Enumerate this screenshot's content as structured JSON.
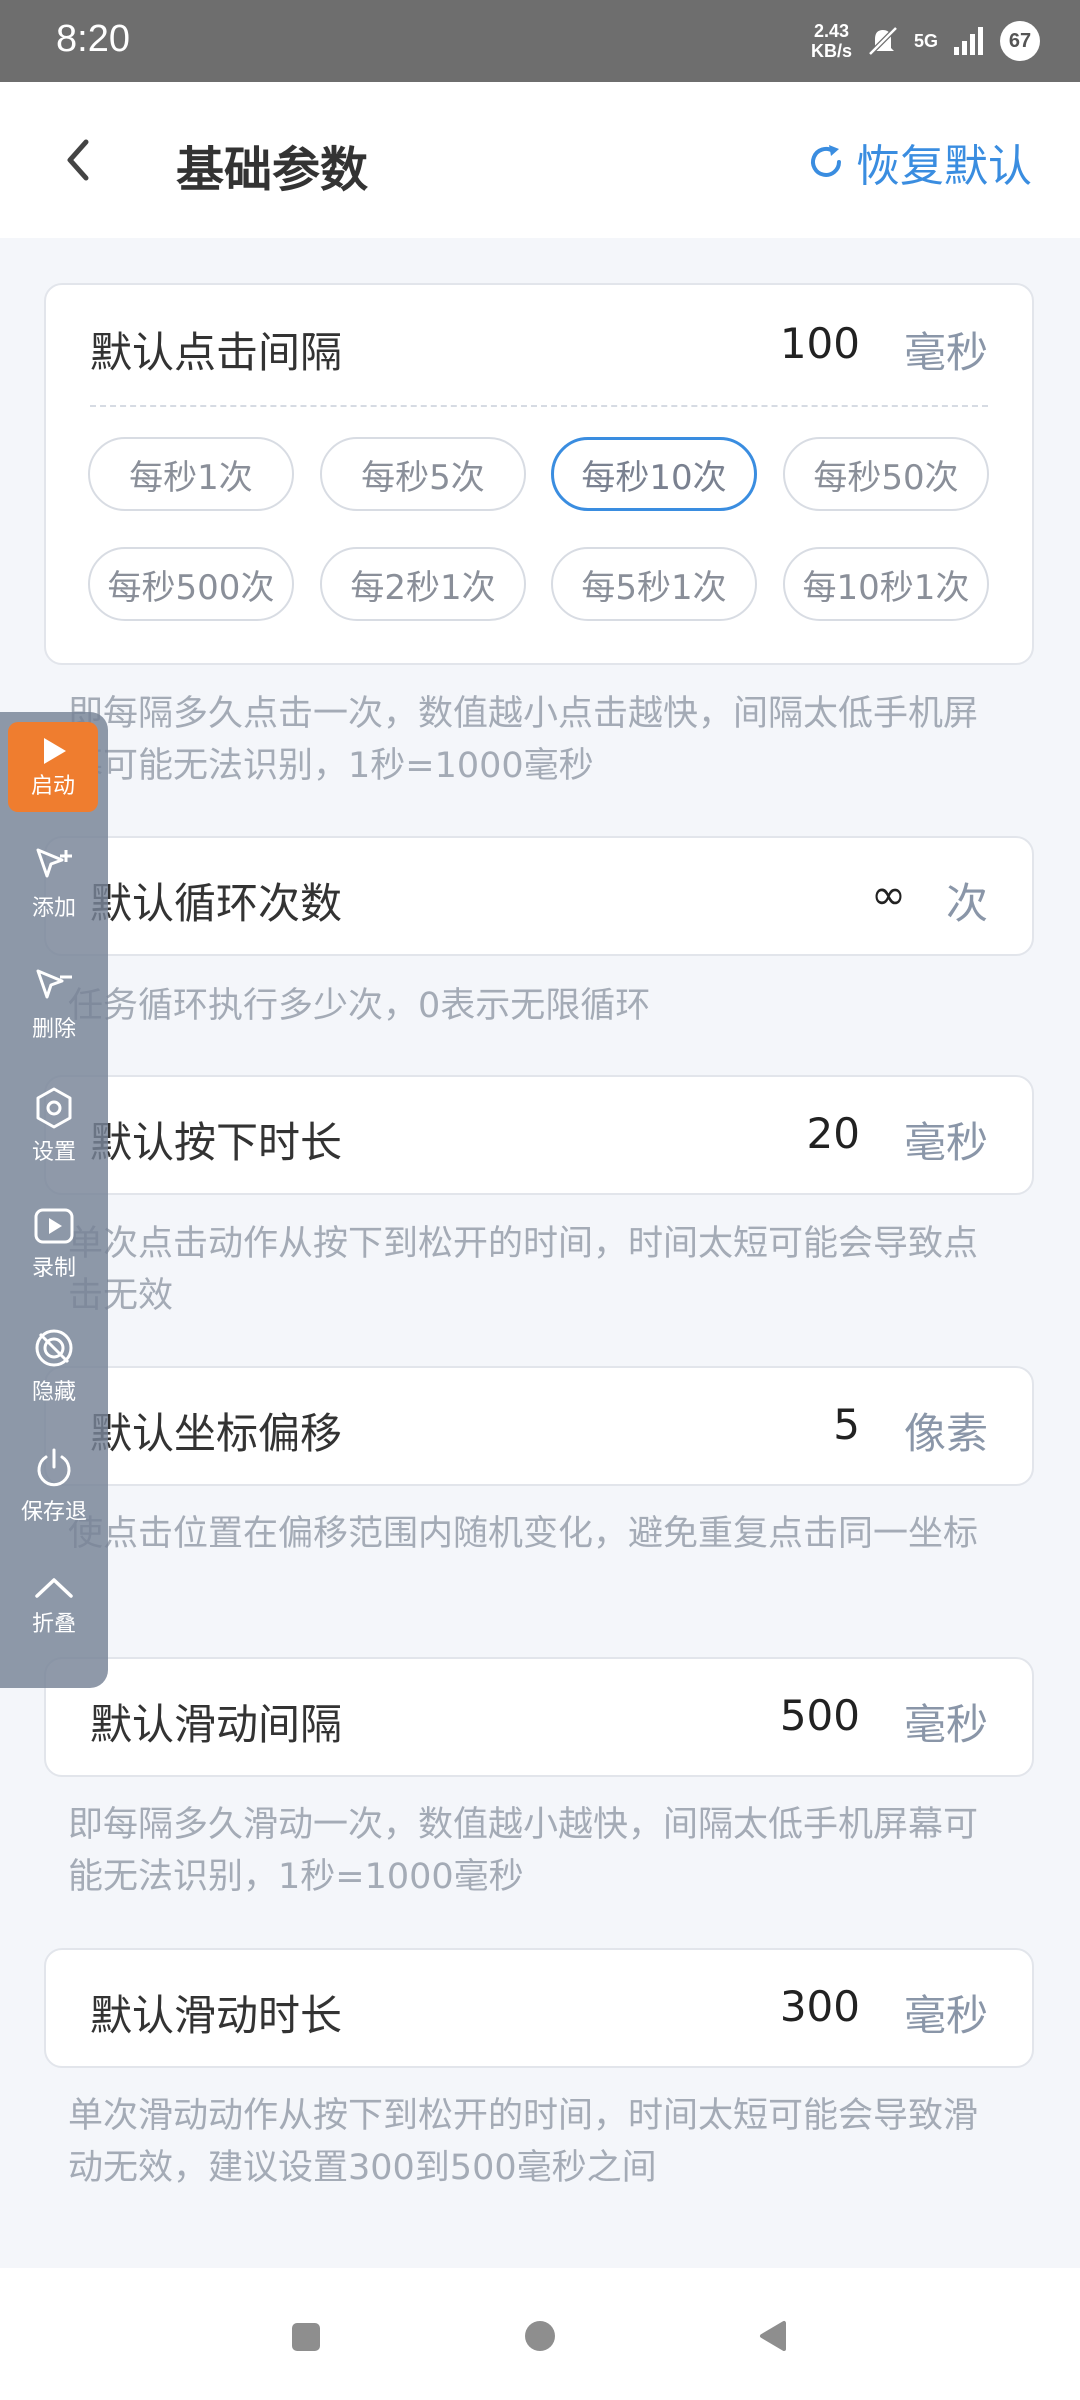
{
  "status_bar": {
    "time": "8:20",
    "speed_value": "2.43",
    "speed_unit": "KB/s",
    "network": "5G",
    "battery": "67"
  },
  "header": {
    "title": "基础参数",
    "restore_label": "恢复默认"
  },
  "settings": {
    "click_interval": {
      "label": "默认点击间隔",
      "value": "100",
      "unit": "毫秒",
      "presets": [
        "每秒1次",
        "每秒5次",
        "每秒10次",
        "每秒50次",
        "每秒500次",
        "每2秒1次",
        "每5秒1次",
        "每10秒1次"
      ],
      "selected_preset": "每秒10次",
      "description": "即每隔多久点击一次，数值越小点击越快，间隔太低手机屏幕可能无法识别，1秒=1000毫秒"
    },
    "loop_count": {
      "label": "默认循环次数",
      "value": "∞",
      "unit": "次",
      "description": "任务循环执行多少次，0表示无限循环"
    },
    "press_duration": {
      "label": "默认按下时长",
      "value": "20",
      "unit": "毫秒",
      "description": "单次点击动作从按下到松开的时间，时间太短可能会导致点击无效"
    },
    "coordinate_offset": {
      "label": "默认坐标偏移",
      "value": "5",
      "unit": "像素",
      "description": "使点击位置在偏移范围内随机变化，避免重复点击同一坐标"
    },
    "swipe_interval": {
      "label": "默认滑动间隔",
      "value": "500",
      "unit": "毫秒",
      "description": "即每隔多久滑动一次，数值越小越快，间隔太低手机屏幕可能无法识别，1秒=1000毫秒"
    },
    "swipe_duration": {
      "label": "默认滑动时长",
      "value": "300",
      "unit": "毫秒",
      "description": "单次滑动动作从按下到松开的时间，时间太短可能会导致滑动无效，建议设置300到500毫秒之间"
    }
  },
  "floating_toolbar": {
    "start": "启动",
    "add": "添加",
    "delete": "删除",
    "settings": "设置",
    "record": "录制",
    "hide": "隐藏",
    "save_exit": "保存退",
    "collapse": "折叠"
  },
  "colors": {
    "accent": "#3a8de0",
    "start_button": "#ef7d2f",
    "toolbar_bg": "#768396"
  }
}
